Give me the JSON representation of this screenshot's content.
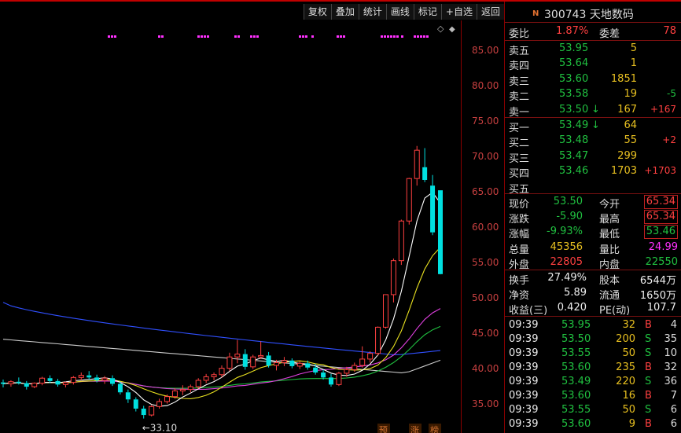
{
  "toolbar": [
    "复权",
    "叠加",
    "统计",
    "画线",
    "标记",
    "+自选",
    "返回"
  ],
  "stock": {
    "badge": "N",
    "title": "300743 天地数码"
  },
  "colors": {
    "up": "#ff4040",
    "down": "#00e0e0",
    "ma5": "#ffffff",
    "ma10": "#e8e020",
    "ma20": "#e040e0",
    "ma30": "#20c040",
    "ma60": "#3050ff",
    "ma120": "#cccccc"
  },
  "axis": {
    "labels": [
      "85.00",
      "80.00",
      "75.00",
      "70.00",
      "65.00",
      "60.00",
      "55.00",
      "50.00",
      "45.00",
      "40.00",
      "35.00"
    ],
    "ymin": 32.5,
    "ymax": 88.0
  },
  "low_marker": "←33.10",
  "bottom_tags": [
    "预",
    "涨",
    "榜"
  ],
  "quote": {
    "wb_label": "委比",
    "wb": "1.87%",
    "wc_label": "委差",
    "wc": "78",
    "sells": [
      {
        "label": "卖五",
        "price": "53.95",
        "vol": "5",
        "chg": ""
      },
      {
        "label": "卖四",
        "price": "53.64",
        "vol": "1",
        "chg": ""
      },
      {
        "label": "卖三",
        "price": "53.60",
        "vol": "1851",
        "chg": ""
      },
      {
        "label": "卖二",
        "price": "53.58",
        "vol": "19",
        "chg": "-5"
      },
      {
        "label": "卖一",
        "price": "53.50",
        "arrow": "↓",
        "vol": "167",
        "chg": "+167"
      }
    ],
    "buys": [
      {
        "label": "买一",
        "price": "53.49",
        "arrow": "↓",
        "vol": "64",
        "chg": ""
      },
      {
        "label": "买二",
        "price": "53.48",
        "vol": "55",
        "chg": "+2"
      },
      {
        "label": "买三",
        "price": "53.47",
        "vol": "299",
        "chg": ""
      },
      {
        "label": "买四",
        "price": "53.46",
        "vol": "1703",
        "chg": "+1703"
      },
      {
        "label": "买五",
        "price": "",
        "vol": "",
        "chg": ""
      }
    ],
    "stats": [
      {
        "l1": "现价",
        "v1": "53.50",
        "l2": "今开",
        "v2": "65.34"
      },
      {
        "l1": "涨跌",
        "v1": "-5.90",
        "l2": "最高",
        "v2": "65.34"
      },
      {
        "l1": "涨幅",
        "v1": "-9.93%",
        "l2": "最低",
        "v2": "53.46"
      },
      {
        "l1": "总量",
        "v1": "45356",
        "l2": "量比",
        "v2": "24.99"
      },
      {
        "l1": "外盘",
        "v1": "22805",
        "l2": "内盘",
        "v2": "22550"
      }
    ],
    "fund": [
      {
        "l1": "换手",
        "v1": "27.49%",
        "l2": "股本",
        "v2": "6544万"
      },
      {
        "l1": "净资",
        "v1": "5.89",
        "l2": "流通",
        "v2": "1650万"
      },
      {
        "l1": "收益(三)",
        "v1": "0.420",
        "l2": "PE(动)",
        "v2": "107.7"
      }
    ],
    "ticks": [
      {
        "time": "09:39",
        "price": "53.95",
        "vol": "32",
        "bs": "B",
        "n": "4"
      },
      {
        "time": "09:39",
        "price": "53.50",
        "vol": "200",
        "bs": "S",
        "n": "35"
      },
      {
        "time": "09:39",
        "price": "53.55",
        "vol": "50",
        "bs": "S",
        "n": "10"
      },
      {
        "time": "09:39",
        "price": "53.60",
        "vol": "235",
        "bs": "B",
        "n": "32"
      },
      {
        "time": "09:39",
        "price": "53.49",
        "vol": "220",
        "bs": "S",
        "n": "36"
      },
      {
        "time": "09:39",
        "price": "53.60",
        "vol": "16",
        "bs": "B",
        "n": "7"
      },
      {
        "time": "09:39",
        "price": "53.55",
        "vol": "50",
        "bs": "S",
        "n": "6"
      },
      {
        "time": "09:39",
        "price": "53.60",
        "vol": "9",
        "bs": "B",
        "n": "6"
      }
    ]
  },
  "chart_data": {
    "type": "candlestick",
    "candles": [
      [
        38.2,
        38.6,
        37.5,
        38.0
      ],
      [
        38.0,
        38.5,
        37.6,
        38.3
      ],
      [
        38.3,
        38.9,
        37.9,
        38.1
      ],
      [
        38.1,
        38.4,
        37.2,
        37.6
      ],
      [
        37.6,
        38.2,
        37.4,
        38.1
      ],
      [
        38.1,
        39.0,
        37.8,
        38.8
      ],
      [
        38.8,
        39.2,
        38.1,
        38.4
      ],
      [
        38.4,
        38.7,
        37.6,
        37.9
      ],
      [
        37.9,
        38.3,
        37.5,
        38.2
      ],
      [
        38.2,
        39.1,
        37.9,
        38.9
      ],
      [
        38.9,
        39.6,
        38.5,
        39.2
      ],
      [
        39.2,
        39.8,
        38.6,
        38.9
      ],
      [
        38.9,
        39.3,
        38.2,
        38.5
      ],
      [
        38.5,
        39.1,
        38.0,
        38.8
      ],
      [
        38.8,
        39.2,
        37.7,
        38.0
      ],
      [
        38.0,
        38.3,
        36.5,
        36.8
      ],
      [
        36.8,
        37.2,
        35.3,
        35.8
      ],
      [
        35.8,
        36.1,
        34.1,
        34.5
      ],
      [
        34.5,
        34.9,
        33.1,
        33.6
      ],
      [
        33.6,
        35.0,
        33.4,
        34.8
      ],
      [
        34.8,
        35.9,
        34.5,
        35.5
      ],
      [
        35.5,
        36.5,
        35.2,
        36.2
      ],
      [
        36.2,
        37.4,
        35.9,
        37.0
      ],
      [
        37.0,
        37.8,
        36.4,
        37.2
      ],
      [
        37.2,
        37.9,
        36.8,
        37.6
      ],
      [
        37.6,
        38.8,
        37.3,
        38.5
      ],
      [
        38.5,
        39.4,
        38.1,
        39.0
      ],
      [
        39.0,
        39.6,
        38.5,
        39.3
      ],
      [
        39.3,
        40.6,
        38.9,
        40.2
      ],
      [
        40.2,
        42.4,
        39.8,
        41.8
      ],
      [
        41.8,
        44.2,
        40.9,
        42.2
      ],
      [
        42.2,
        42.9,
        40.0,
        40.4
      ],
      [
        40.4,
        42.1,
        40.1,
        41.8
      ],
      [
        41.8,
        44.0,
        41.5,
        42.0
      ],
      [
        42.0,
        42.5,
        40.3,
        40.6
      ],
      [
        40.6,
        41.4,
        39.9,
        41.0
      ],
      [
        41.0,
        41.8,
        40.5,
        41.3
      ],
      [
        41.3,
        41.6,
        40.2,
        40.5
      ],
      [
        40.5,
        41.2,
        40.1,
        40.9
      ],
      [
        40.9,
        41.3,
        40.0,
        40.3
      ],
      [
        40.3,
        40.8,
        39.3,
        39.6
      ],
      [
        39.6,
        40.0,
        38.6,
        38.9
      ],
      [
        38.9,
        39.4,
        37.6,
        37.9
      ],
      [
        37.9,
        39.7,
        37.7,
        39.5
      ],
      [
        39.5,
        40.4,
        39.0,
        40.0
      ],
      [
        40.0,
        41.0,
        39.7,
        40.6
      ],
      [
        40.6,
        43.3,
        40.3,
        41.5
      ],
      [
        41.5,
        42.6,
        41.0,
        42.3
      ],
      [
        42.3,
        46.1,
        42.0,
        46.0
      ],
      [
        46.0,
        50.6,
        45.8,
        50.6
      ],
      [
        50.6,
        55.7,
        49.5,
        55.4
      ],
      [
        55.4,
        61.2,
        54.8,
        61.0
      ],
      [
        61.0,
        67.1,
        60.5,
        67.0
      ],
      [
        67.0,
        71.6,
        66.0,
        71.0
      ],
      [
        68.6,
        71.3,
        66.5,
        66.8
      ],
      [
        66.0,
        67.5,
        59.0,
        59.4
      ],
      [
        65.34,
        65.34,
        53.46,
        53.5
      ]
    ]
  }
}
